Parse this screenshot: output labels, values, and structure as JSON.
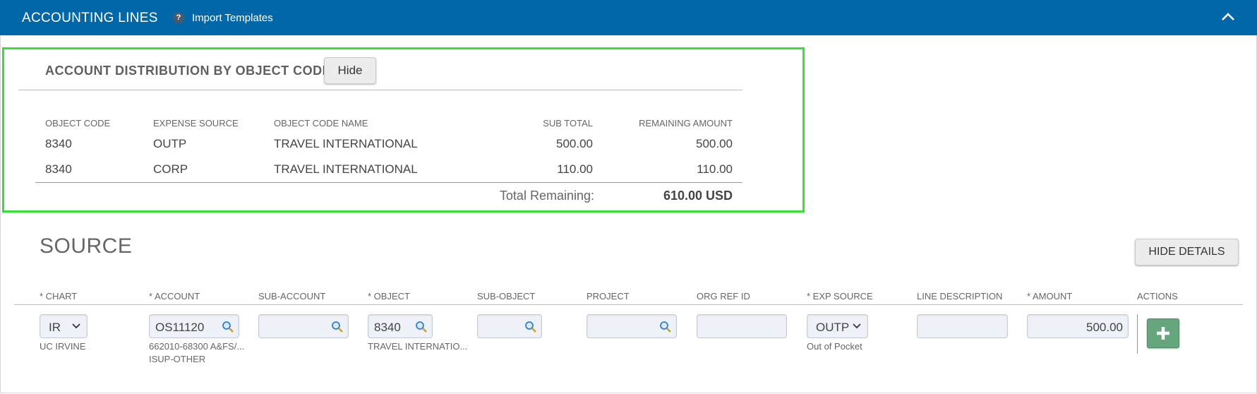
{
  "header": {
    "title": "ACCOUNTING LINES",
    "help_glyph": "?",
    "import_label": "Import Templates",
    "collapse_icon": "chevron-up-icon"
  },
  "distribution": {
    "title": "ACCOUNT DISTRIBUTION BY OBJECT CODE",
    "hide_label": "Hide",
    "columns": [
      "OBJECT CODE",
      "EXPENSE SOURCE",
      "OBJECT CODE NAME",
      "SUB TOTAL",
      "REMAINING AMOUNT"
    ],
    "rows": [
      {
        "object_code": "8340",
        "expense_source": "OUTP",
        "name": "TRAVEL INTERNATIONAL",
        "sub_total": "500.00",
        "remaining": "500.00"
      },
      {
        "object_code": "8340",
        "expense_source": "CORP",
        "name": "TRAVEL INTERNATIONAL",
        "sub_total": "110.00",
        "remaining": "110.00"
      }
    ],
    "total_label": "Total Remaining:",
    "total_value": "610.00 USD",
    "highlight_color": "#33e333"
  },
  "source": {
    "title": "SOURCE",
    "hide_details_label": "HIDE DETAILS",
    "columns": [
      "* CHART",
      "* ACCOUNT",
      "SUB-ACCOUNT",
      "* OBJECT",
      "SUB-OBJECT",
      "PROJECT",
      "ORG REF ID",
      "* EXP SOURCE",
      "LINE DESCRIPTION",
      "* AMOUNT",
      "ACTIONS"
    ],
    "line": {
      "chart": "IR",
      "chart_desc": "UC IRVINE",
      "account": "OS11120",
      "account_desc_1": "662010-68300 A&FS/...",
      "account_desc_2": "ISUP-OTHER",
      "sub_account": "",
      "object": "8340",
      "object_desc": "TRAVEL INTERNATIO...",
      "sub_object": "",
      "project": "",
      "org_ref_id": "",
      "exp_source": "OUTP",
      "exp_source_desc": "Out of Pocket",
      "line_description": "",
      "amount": "500.00",
      "add_icon": "plus-icon"
    }
  },
  "colors": {
    "header_bg": "#0067a8",
    "add_button": "#66a67c"
  }
}
